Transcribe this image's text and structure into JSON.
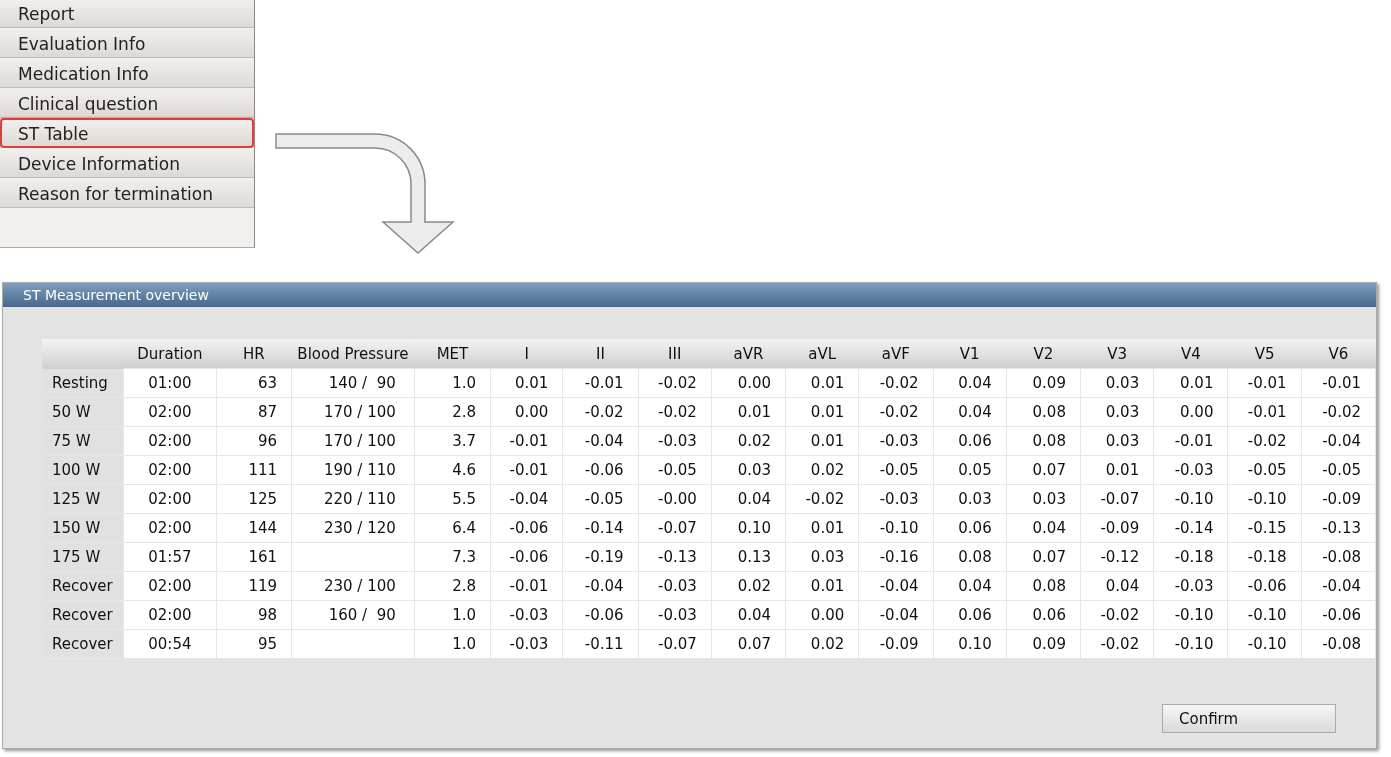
{
  "menu": {
    "items": [
      {
        "label": "Report",
        "selected": false
      },
      {
        "label": "Evaluation Info",
        "selected": false
      },
      {
        "label": "Medication Info",
        "selected": false
      },
      {
        "label": "Clinical question",
        "selected": false
      },
      {
        "label": "ST Table",
        "selected": true
      },
      {
        "label": "Device Information",
        "selected": false
      },
      {
        "label": "Reason for termination",
        "selected": false
      }
    ]
  },
  "dialog": {
    "title": "ST Measurement overview",
    "table": {
      "columns": [
        "Duration",
        "HR",
        "Blood Pressure",
        "MET",
        "I",
        "II",
        "III",
        "aVR",
        "aVL",
        "aVF",
        "V1",
        "V2",
        "V3",
        "V4",
        "V5",
        "V6"
      ],
      "rows": [
        {
          "label": "Resting",
          "cells": [
            "01:00",
            "63",
            "140 /  90",
            "1.0",
            "0.01",
            "-0.01",
            "-0.02",
            "0.00",
            "0.01",
            "-0.02",
            "0.04",
            "0.09",
            "0.03",
            "0.01",
            "-0.01",
            "-0.01"
          ]
        },
        {
          "label": "50 W",
          "cells": [
            "02:00",
            "87",
            "170 / 100",
            "2.8",
            "0.00",
            "-0.02",
            "-0.02",
            "0.01",
            "0.01",
            "-0.02",
            "0.04",
            "0.08",
            "0.03",
            "0.00",
            "-0.01",
            "-0.02"
          ]
        },
        {
          "label": "75 W",
          "cells": [
            "02:00",
            "96",
            "170 / 100",
            "3.7",
            "-0.01",
            "-0.04",
            "-0.03",
            "0.02",
            "0.01",
            "-0.03",
            "0.06",
            "0.08",
            "0.03",
            "-0.01",
            "-0.02",
            "-0.04"
          ]
        },
        {
          "label": "100 W",
          "cells": [
            "02:00",
            "111",
            "190 / 110",
            "4.6",
            "-0.01",
            "-0.06",
            "-0.05",
            "0.03",
            "0.02",
            "-0.05",
            "0.05",
            "0.07",
            "0.01",
            "-0.03",
            "-0.05",
            "-0.05"
          ]
        },
        {
          "label": "125 W",
          "cells": [
            "02:00",
            "125",
            "220 / 110",
            "5.5",
            "-0.04",
            "-0.05",
            "-0.00",
            "0.04",
            "-0.02",
            "-0.03",
            "0.03",
            "0.03",
            "-0.07",
            "-0.10",
            "-0.10",
            "-0.09"
          ]
        },
        {
          "label": "150 W",
          "cells": [
            "02:00",
            "144",
            "230 / 120",
            "6.4",
            "-0.06",
            "-0.14",
            "-0.07",
            "0.10",
            "0.01",
            "-0.10",
            "0.06",
            "0.04",
            "-0.09",
            "-0.14",
            "-0.15",
            "-0.13"
          ]
        },
        {
          "label": "175 W",
          "cells": [
            "01:57",
            "161",
            null,
            "7.3",
            "-0.06",
            "-0.19",
            "-0.13",
            "0.13",
            "0.03",
            "-0.16",
            "0.08",
            "0.07",
            "-0.12",
            "-0.18",
            "-0.18",
            "-0.08"
          ]
        },
        {
          "label": "Recover",
          "cells": [
            "02:00",
            "119",
            "230 / 100",
            "2.8",
            "-0.01",
            "-0.04",
            "-0.03",
            "0.02",
            "0.01",
            "-0.04",
            "0.04",
            "0.08",
            "0.04",
            "-0.03",
            "-0.06",
            "-0.04"
          ]
        },
        {
          "label": "Recover",
          "cells": [
            "02:00",
            "98",
            "160 /  90",
            "1.0",
            "-0.03",
            "-0.06",
            "-0.03",
            "0.04",
            "0.00",
            "-0.04",
            "0.06",
            "0.06",
            "-0.02",
            "-0.10",
            "-0.10",
            "-0.06"
          ]
        },
        {
          "label": "Recover",
          "cells": [
            "00:54",
            "95",
            null,
            "1.0",
            "-0.03",
            "-0.11",
            "-0.07",
            "0.07",
            "0.02",
            "-0.09",
            "0.10",
            "0.09",
            "-0.02",
            "-0.10",
            "-0.10",
            "-0.08"
          ]
        }
      ]
    },
    "buttons": [
      "Confirm"
    ]
  }
}
